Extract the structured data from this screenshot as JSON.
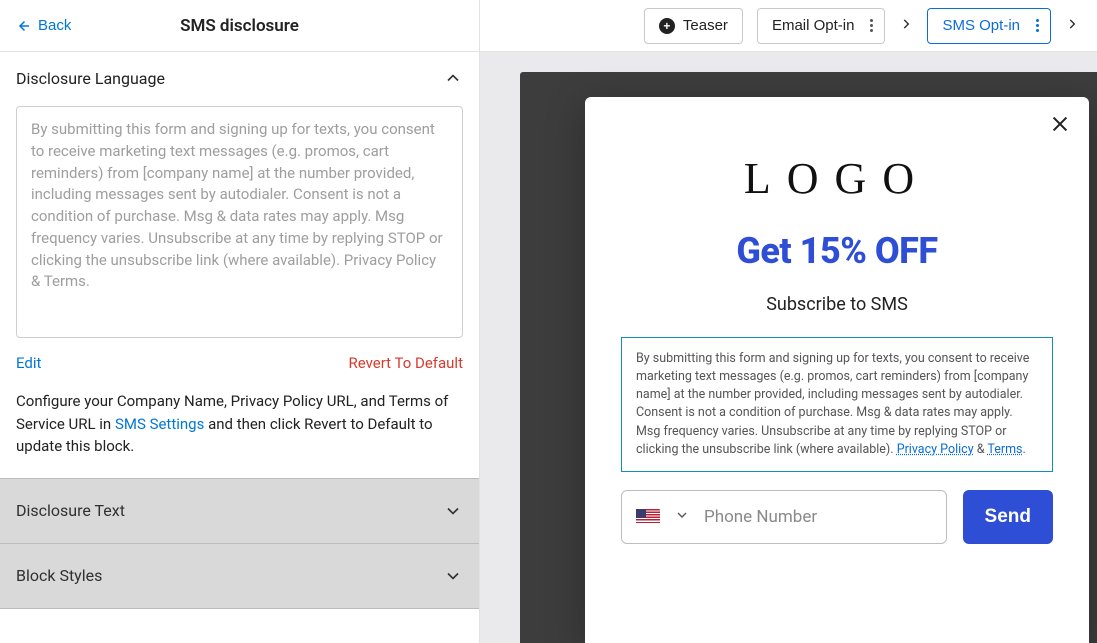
{
  "header": {
    "back_label": "Back",
    "title": "SMS disclosure"
  },
  "steps": {
    "teaser_label": "Teaser",
    "email_label": "Email Opt-in",
    "sms_label": "SMS Opt-in"
  },
  "section_open": {
    "title": "Disclosure Language",
    "textarea_value": "By submitting this form and signing up for texts, you consent to receive marketing text messages (e.g. promos, cart reminders) from [company name] at the number provided, including messages sent by autodialer. Consent is not a condition of purchase. Msg & data rates may apply. Msg frequency varies. Unsubscribe at any time by replying STOP or clicking the unsubscribe link (where available). Privacy Policy & Terms.",
    "edit_label": "Edit",
    "revert_label": "Revert To Default",
    "helper_prefix": "Configure your Company Name, Privacy Policy URL, and Terms of Service URL in ",
    "helper_link": "SMS Settings",
    "helper_suffix": " and then click Revert to Default to update this block."
  },
  "sections_collapsed": [
    {
      "title": "Disclosure Text"
    },
    {
      "title": "Block Styles"
    }
  ],
  "popup": {
    "logo_text": "LOGO",
    "headline": "Get 15% OFF",
    "subhead": "Subscribe to SMS",
    "disclosure_prefix": "By submitting this form and signing up for texts, you consent to receive marketing text messages (e.g. promos, cart reminders) from [company name] at the number provided, including messages sent by autodialer. Consent is not a condition of purchase. Msg & data rates may apply. Msg frequency varies. Unsubscribe at any time by replying STOP or clicking the unsubscribe link (where available). ",
    "privacy_label": "Privacy Policy",
    "amp": " & ",
    "terms_label": "Terms",
    "period": ".",
    "phone_placeholder": "Phone Number",
    "send_label": "Send"
  }
}
